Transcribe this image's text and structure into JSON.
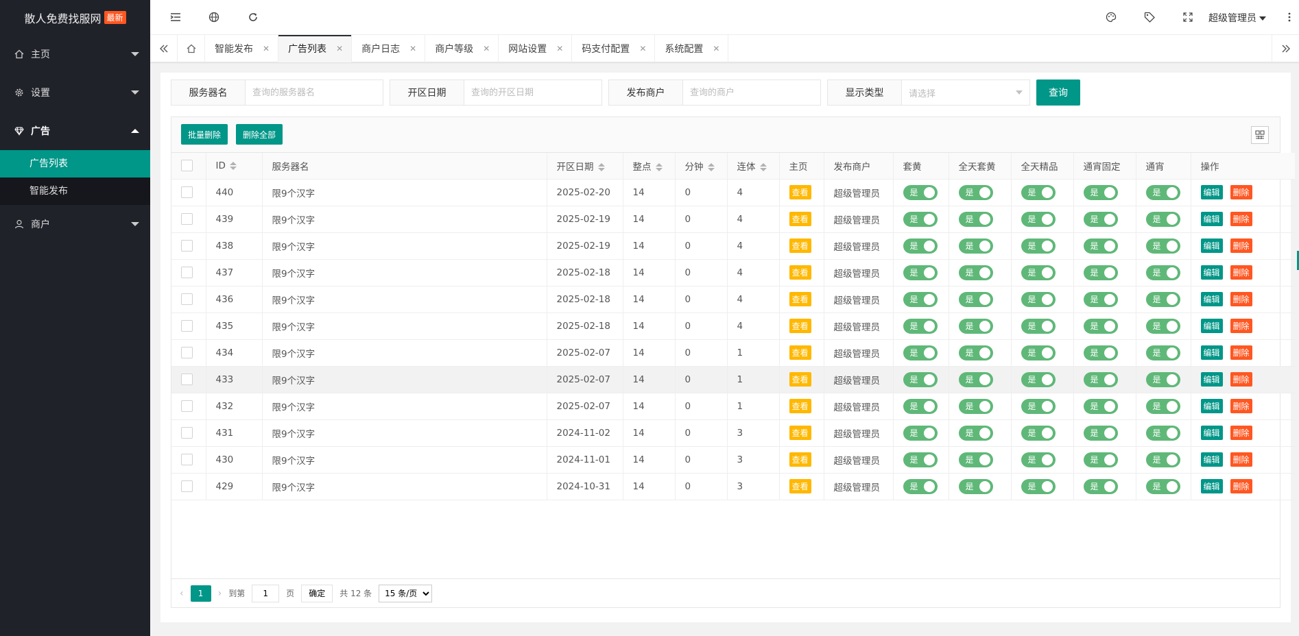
{
  "sidebar": {
    "logo_text": "散人免费找服网",
    "logo_badge": "最新",
    "items": [
      {
        "label": "主页"
      },
      {
        "label": "设置"
      },
      {
        "label": "广告"
      },
      {
        "label": "商户"
      }
    ],
    "ad_sub": [
      {
        "label": "广告列表"
      },
      {
        "label": "智能发布"
      }
    ]
  },
  "header": {
    "user": "超级管理员"
  },
  "tabs": [
    {
      "label": "智能发布"
    },
    {
      "label": "广告列表"
    },
    {
      "label": "商户日志"
    },
    {
      "label": "商户等级"
    },
    {
      "label": "网站设置"
    },
    {
      "label": "码支付配置"
    },
    {
      "label": "系统配置"
    }
  ],
  "search": {
    "server_label": "服务器名",
    "server_placeholder": "查询的服务器名",
    "date_label": "开区日期",
    "date_placeholder": "查询的开区日期",
    "merchant_label": "发布商户",
    "merchant_placeholder": "查询的商户",
    "type_label": "显示类型",
    "type_placeholder": "请选择",
    "query_button": "查询"
  },
  "toolbar": {
    "batch_delete": "批量删除",
    "delete_all": "删除全部"
  },
  "table": {
    "headers": [
      "ID",
      "服务器名",
      "开区日期",
      "整点",
      "分钟",
      "连体",
      "主页",
      "发布商户",
      "套黄",
      "全天套黄",
      "全天精品",
      "通宵固定",
      "通宵",
      "操作"
    ],
    "view_label": "查看",
    "toggle_label": "是",
    "edit_label": "编辑",
    "delete_label": "删除",
    "rows": [
      {
        "id": "440",
        "name": "限9个汉字",
        "date": "2025-02-20",
        "hour": "14",
        "minute": "0",
        "link": "4",
        "merchant": "超级管理员"
      },
      {
        "id": "439",
        "name": "限9个汉字",
        "date": "2025-02-19",
        "hour": "14",
        "minute": "0",
        "link": "4",
        "merchant": "超级管理员"
      },
      {
        "id": "438",
        "name": "限9个汉字",
        "date": "2025-02-19",
        "hour": "14",
        "minute": "0",
        "link": "4",
        "merchant": "超级管理员"
      },
      {
        "id": "437",
        "name": "限9个汉字",
        "date": "2025-02-18",
        "hour": "14",
        "minute": "0",
        "link": "4",
        "merchant": "超级管理员"
      },
      {
        "id": "436",
        "name": "限9个汉字",
        "date": "2025-02-18",
        "hour": "14",
        "minute": "0",
        "link": "4",
        "merchant": "超级管理员"
      },
      {
        "id": "435",
        "name": "限9个汉字",
        "date": "2025-02-18",
        "hour": "14",
        "minute": "0",
        "link": "4",
        "merchant": "超级管理员"
      },
      {
        "id": "434",
        "name": "限9个汉字",
        "date": "2025-02-07",
        "hour": "14",
        "minute": "0",
        "link": "1",
        "merchant": "超级管理员"
      },
      {
        "id": "433",
        "name": "限9个汉字",
        "date": "2025-02-07",
        "hour": "14",
        "minute": "0",
        "link": "1",
        "merchant": "超级管理员"
      },
      {
        "id": "432",
        "name": "限9个汉字",
        "date": "2025-02-07",
        "hour": "14",
        "minute": "0",
        "link": "1",
        "merchant": "超级管理员"
      },
      {
        "id": "431",
        "name": "限9个汉字",
        "date": "2024-11-02",
        "hour": "14",
        "minute": "0",
        "link": "3",
        "merchant": "超级管理员"
      },
      {
        "id": "430",
        "name": "限9个汉字",
        "date": "2024-11-01",
        "hour": "14",
        "minute": "0",
        "link": "3",
        "merchant": "超级管理员"
      },
      {
        "id": "429",
        "name": "限9个汉字",
        "date": "2024-10-31",
        "hour": "14",
        "minute": "0",
        "link": "3",
        "merchant": "超级管理员"
      }
    ]
  },
  "pager": {
    "current": "1",
    "goto_label": "到第",
    "page_value": "1",
    "page_unit": "页",
    "confirm": "确定",
    "total": "共 12 条",
    "per_page": "15 条/页"
  },
  "colors": {
    "accent": "#009688",
    "sidebar": "#20222a",
    "warning": "#ffb800",
    "danger": "#ff5722",
    "toggle_on": "#5fb878"
  }
}
